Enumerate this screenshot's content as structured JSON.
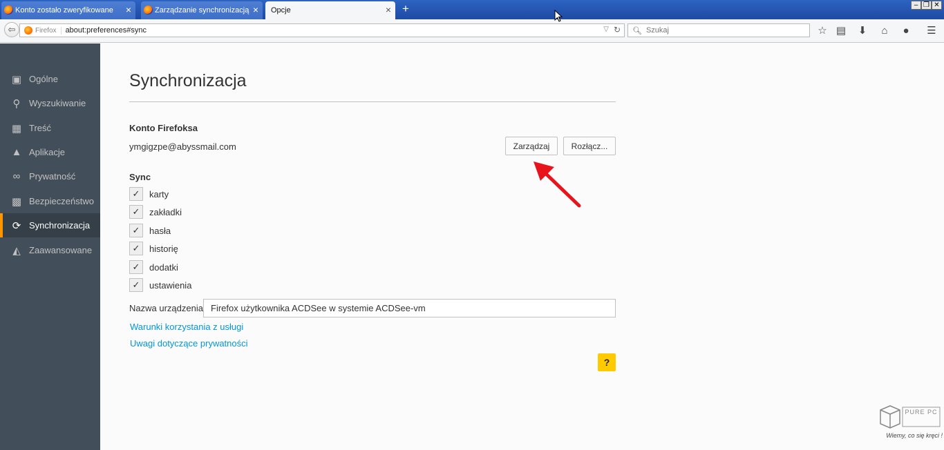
{
  "tabs": [
    {
      "label": "Konto zostało zweryfikowane",
      "close": "×"
    },
    {
      "label": "Zarządzanie synchronizacją",
      "close": "×"
    },
    {
      "label": "Opcje",
      "close": "×"
    }
  ],
  "new_tab": "+",
  "url": {
    "brand": "Firefox",
    "address": "about:preferences#sync"
  },
  "search": {
    "placeholder": "Szukaj"
  },
  "sidebar": {
    "items": [
      {
        "label": "Ogólne"
      },
      {
        "label": "Wyszukiwanie"
      },
      {
        "label": "Treść"
      },
      {
        "label": "Aplikacje"
      },
      {
        "label": "Prywatność"
      },
      {
        "label": "Bezpieczeństwo"
      },
      {
        "label": "Synchronizacja"
      },
      {
        "label": "Zaawansowane"
      }
    ],
    "selected": "Synchronizacja"
  },
  "main": {
    "title": "Synchronizacja",
    "account_heading": "Konto Firefoksa",
    "email": "ymgigzpe@abyssmail.com",
    "manage_button": "Zarządzaj",
    "disconnect_button": "Rozłącz...",
    "sync_heading": "Sync",
    "sync_options": [
      {
        "label": "karty",
        "checked": true
      },
      {
        "label": "zakładki",
        "checked": true
      },
      {
        "label": "hasła",
        "checked": true
      },
      {
        "label": "historię",
        "checked": true
      },
      {
        "label": "dodatki",
        "checked": true
      },
      {
        "label": "ustawienia",
        "checked": true
      }
    ],
    "device_name_label": "Nazwa urządzenia:",
    "device_name_value": "Firefox użytkownika ACDSee w systemie ACDSee-vm",
    "terms_link": "Warunki korzystania z usługi",
    "privacy_link": "Uwagi dotyczące prywatności",
    "help_button": "?"
  },
  "watermark": {
    "brand": "PURE PC",
    "slogan": "Wiemy, co się kręci !"
  },
  "colors": {
    "accent": "#ff9500",
    "sidebar": "#424f5a",
    "link": "#0095dd",
    "help": "#ffcb00",
    "arrow": "#e8141b"
  }
}
